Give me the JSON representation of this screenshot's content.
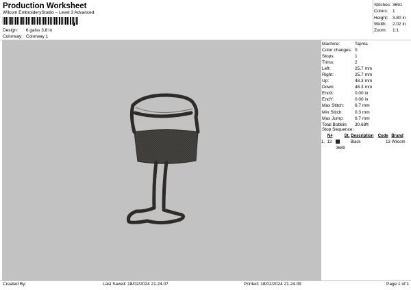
{
  "header": {
    "title": "Production Worksheet",
    "subtitle": "Wilcom EmbroideryStudio – Level 3 Advanced",
    "design_label": "Design:",
    "design_value": "6 galss 3,8 in",
    "colorway_label": "Colorway:",
    "colorway_value": "Colorway 1"
  },
  "stats": [
    {
      "label": "Stitches:",
      "value": "3691"
    },
    {
      "label": "Colors:",
      "value": "1"
    },
    {
      "label": "Height:",
      "value": "3.80 in"
    },
    {
      "label": "Width:",
      "value": "2.02 in"
    },
    {
      "label": "Zoom:",
      "value": "1:1"
    }
  ],
  "machine": [
    {
      "label": "Machine:",
      "value": "Tajima"
    },
    {
      "label": "Color changes:",
      "value": "0"
    },
    {
      "label": "Stops:",
      "value": "1"
    },
    {
      "label": "Trims:",
      "value": "2"
    },
    {
      "label": "Left:",
      "value": "25.7 mm"
    },
    {
      "label": "Right:",
      "value": "25.7 mm"
    },
    {
      "label": "Up:",
      "value": "48.3 mm"
    },
    {
      "label": "Down:",
      "value": "48.3 mm"
    },
    {
      "label": "EndX:",
      "value": "0.00 in"
    },
    {
      "label": "EndY:",
      "value": "0.00 in"
    },
    {
      "label": "Max Stitch:",
      "value": "6.7 mm"
    },
    {
      "label": "Min Stitch:",
      "value": "0.3 mm"
    },
    {
      "label": "Max Jump:",
      "value": "6.7 mm"
    },
    {
      "label": "Total Bobbin:",
      "value": "30.68ft"
    }
  ],
  "stop_sequence": {
    "title": "Stop Sequence:",
    "headers": [
      "N#",
      "St.",
      "Description",
      "Code",
      "Brand"
    ],
    "rows": [
      {
        "index": "1.",
        "n": "13",
        "stitches": "3689",
        "description": "Black",
        "code": "13",
        "brand": "Wilcom",
        "color": "#222222"
      }
    ]
  },
  "footer": {
    "created_by": "Created By:",
    "last_saved": "Last Saved: 18/02/2024 21.24.07",
    "printed": "Printed: 18/02/2024 21.24.09",
    "page": "Page 1 of 1"
  }
}
